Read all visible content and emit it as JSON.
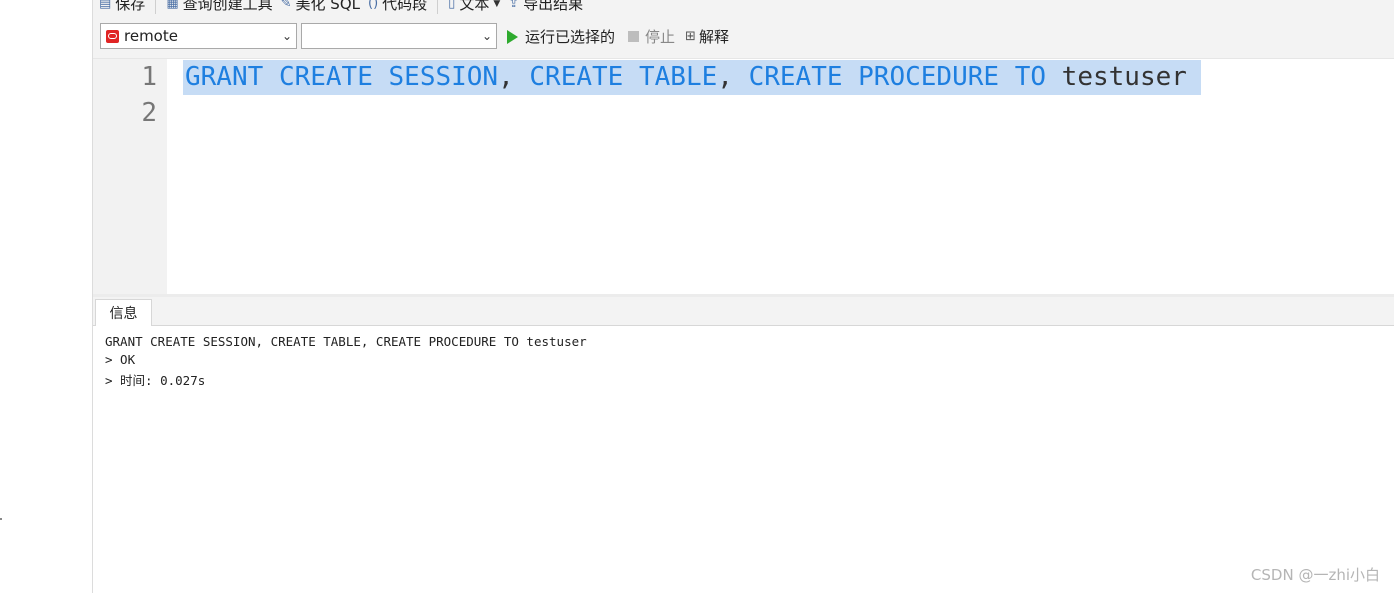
{
  "toolbar_top": {
    "save": "保存",
    "query_builder": "查询创建工具",
    "beautify": "美化 SQL",
    "snippet": "代码段",
    "text": "文本",
    "export": "导出结果"
  },
  "toolbar": {
    "connection": "remote",
    "database": "",
    "run_selected": "运行已选择的",
    "stop": "停止",
    "explain": "解释"
  },
  "editor": {
    "line_numbers": [
      "1",
      "2"
    ],
    "tokens": [
      "GRANT",
      "CREATE",
      "SESSION",
      ",",
      "CREATE",
      "TABLE",
      ",",
      "CREATE",
      "PROCEDURE",
      "TO",
      "testuser"
    ]
  },
  "results": {
    "tab_label": "信息",
    "messages": [
      "GRANT CREATE SESSION, CREATE TABLE, CREATE PROCEDURE TO testuser",
      "> OK",
      "> 时间: 0.027s"
    ]
  },
  "watermark": "CSDN @一zhi小白",
  "colors": {
    "keyword": "#1e7fe0",
    "selection": "#c6dcf5",
    "run": "#2eaa2e",
    "connection": "#e02424"
  },
  "icons": [
    "save-icon",
    "query-builder-icon",
    "beautify-icon",
    "snippet-icon",
    "text-icon",
    "export-icon",
    "oracle-connection-icon",
    "play-icon",
    "stop-icon",
    "explain-icon"
  ]
}
